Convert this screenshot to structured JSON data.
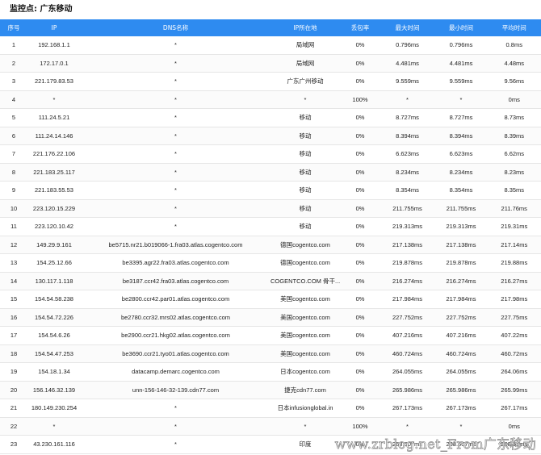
{
  "title": "监控点: 广东移动",
  "columns": [
    "序号",
    "IP",
    "DNS名称",
    "IP所在地",
    "丢包率",
    "最大时间",
    "最小时间",
    "平均时间"
  ],
  "rows": [
    {
      "no": "1",
      "ip": "192.168.1.1",
      "dns": "*",
      "loc": "局域网",
      "loss": "0%",
      "max": "0.796ms",
      "min": "0.796ms",
      "avg": "0.8ms"
    },
    {
      "no": "2",
      "ip": "172.17.0.1",
      "dns": "*",
      "loc": "局域网",
      "loss": "0%",
      "max": "4.481ms",
      "min": "4.481ms",
      "avg": "4.48ms"
    },
    {
      "no": "3",
      "ip": "221.179.83.53",
      "dns": "*",
      "loc": "广东广州移动",
      "loss": "0%",
      "max": "9.559ms",
      "min": "9.559ms",
      "avg": "9.56ms"
    },
    {
      "no": "4",
      "ip": "*",
      "dns": "*",
      "loc": "*",
      "loss": "100%",
      "max": "*",
      "min": "*",
      "avg": "0ms"
    },
    {
      "no": "5",
      "ip": "111.24.5.21",
      "dns": "*",
      "loc": "移动",
      "loss": "0%",
      "max": "8.727ms",
      "min": "8.727ms",
      "avg": "8.73ms"
    },
    {
      "no": "6",
      "ip": "111.24.14.146",
      "dns": "*",
      "loc": "移动",
      "loss": "0%",
      "max": "8.394ms",
      "min": "8.394ms",
      "avg": "8.39ms"
    },
    {
      "no": "7",
      "ip": "221.176.22.106",
      "dns": "*",
      "loc": "移动",
      "loss": "0%",
      "max": "6.623ms",
      "min": "6.623ms",
      "avg": "6.62ms"
    },
    {
      "no": "8",
      "ip": "221.183.25.117",
      "dns": "*",
      "loc": "移动",
      "loss": "0%",
      "max": "8.234ms",
      "min": "8.234ms",
      "avg": "8.23ms"
    },
    {
      "no": "9",
      "ip": "221.183.55.53",
      "dns": "*",
      "loc": "移动",
      "loss": "0%",
      "max": "8.354ms",
      "min": "8.354ms",
      "avg": "8.35ms"
    },
    {
      "no": "10",
      "ip": "223.120.15.229",
      "dns": "*",
      "loc": "移动",
      "loss": "0%",
      "max": "211.755ms",
      "min": "211.755ms",
      "avg": "211.76ms"
    },
    {
      "no": "11",
      "ip": "223.120.10.42",
      "dns": "*",
      "loc": "移动",
      "loss": "0%",
      "max": "219.313ms",
      "min": "219.313ms",
      "avg": "219.31ms"
    },
    {
      "no": "12",
      "ip": "149.29.9.161",
      "dns": "be5715.nr21.b019066-1.fra03.atlas.cogentco.com",
      "loc": "德国cogentco.com",
      "loss": "0%",
      "max": "217.138ms",
      "min": "217.138ms",
      "avg": "217.14ms"
    },
    {
      "no": "13",
      "ip": "154.25.12.66",
      "dns": "be3395.agr22.fra03.atlas.cogentco.com",
      "loc": "德国cogentco.com",
      "loss": "0%",
      "max": "219.878ms",
      "min": "219.878ms",
      "avg": "219.88ms"
    },
    {
      "no": "14",
      "ip": "130.117.1.118",
      "dns": "be3187.ccr42.fra03.atlas.cogentco.com",
      "loc": "COGENTCO.COM 骨干...",
      "loss": "0%",
      "max": "216.274ms",
      "min": "216.274ms",
      "avg": "216.27ms"
    },
    {
      "no": "15",
      "ip": "154.54.58.238",
      "dns": "be2800.ccr42.par01.atlas.cogentco.com",
      "loc": "美国cogentco.com",
      "loss": "0%",
      "max": "217.984ms",
      "min": "217.984ms",
      "avg": "217.98ms"
    },
    {
      "no": "16",
      "ip": "154.54.72.226",
      "dns": "be2780.ccr32.mrs02.atlas.cogentco.com",
      "loc": "美国cogentco.com",
      "loss": "0%",
      "max": "227.752ms",
      "min": "227.752ms",
      "avg": "227.75ms"
    },
    {
      "no": "17",
      "ip": "154.54.6.26",
      "dns": "be2900.ccr21.hkg02.atlas.cogentco.com",
      "loc": "美国cogentco.com",
      "loss": "0%",
      "max": "407.216ms",
      "min": "407.216ms",
      "avg": "407.22ms"
    },
    {
      "no": "18",
      "ip": "154.54.47.253",
      "dns": "be3690.ccr21.tyo01.atlas.cogentco.com",
      "loc": "美国cogentco.com",
      "loss": "0%",
      "max": "460.724ms",
      "min": "460.724ms",
      "avg": "460.72ms"
    },
    {
      "no": "19",
      "ip": "154.18.1.34",
      "dns": "datacamp.demarc.cogentco.com",
      "loc": "日本cogentco.com",
      "loss": "0%",
      "max": "264.055ms",
      "min": "264.055ms",
      "avg": "264.06ms"
    },
    {
      "no": "20",
      "ip": "156.146.32.139",
      "dns": "unn-156-146-32-139.cdn77.com",
      "loc": "捷克cdn77.com",
      "loss": "0%",
      "max": "265.986ms",
      "min": "265.986ms",
      "avg": "265.99ms"
    },
    {
      "no": "21",
      "ip": "180.149.230.254",
      "dns": "*",
      "loc": "日本infusionglobal.in",
      "loss": "0%",
      "max": "267.173ms",
      "min": "267.173ms",
      "avg": "267.17ms"
    },
    {
      "no": "22",
      "ip": "*",
      "dns": "*",
      "loc": "*",
      "loss": "100%",
      "max": "*",
      "min": "*",
      "avg": "0ms"
    },
    {
      "no": "23",
      "ip": "43.230.161.116",
      "dns": "*",
      "loc": "印度",
      "loss": "0%",
      "max": "268.607ms",
      "min": "268.607ms",
      "avg": "268.61ms"
    }
  ],
  "watermark": "www.zrblog.net_From广东移动",
  "colors": {
    "header_bg": "#2e8bf0",
    "header_text": "#ffffff",
    "row_border": "#e6e6e6",
    "text": "#222222"
  }
}
